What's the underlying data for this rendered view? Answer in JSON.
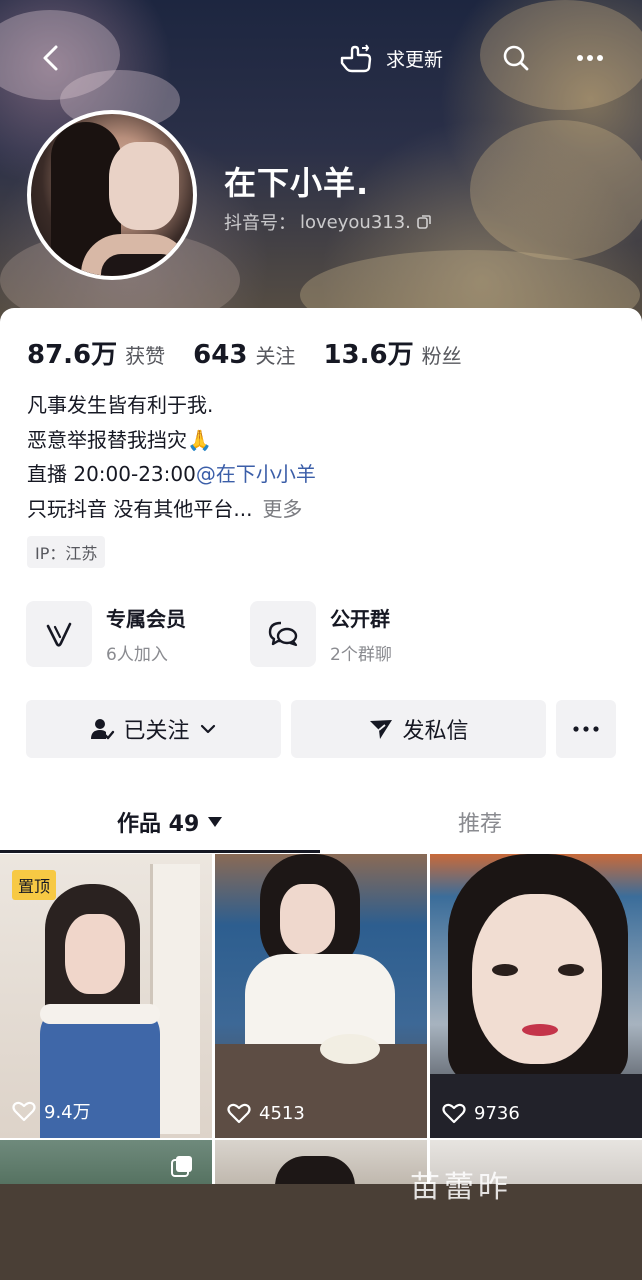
{
  "header": {
    "update_label": "求更新",
    "name": "在下小羊.",
    "douyin_id_label": "抖音号：",
    "douyin_id": "loveyou313."
  },
  "stats": [
    {
      "value": "87.6万",
      "label": "获赞"
    },
    {
      "value": "643",
      "label": "关注"
    },
    {
      "value": "13.6万",
      "label": "粉丝"
    }
  ],
  "bio": {
    "line1": "凡事发生皆有利于我.",
    "line2": "恶意举报替我挡灾🙏",
    "line3_prefix": "直播 20:00-23:00",
    "line3_mention": "@在下小小羊",
    "line4": "只玩抖音 没有其他平台...",
    "more": "更多"
  },
  "ip": "IP：江苏",
  "features": [
    {
      "title": "专属会员",
      "subtitle": "6人加入"
    },
    {
      "title": "公开群",
      "subtitle": "2个群聊"
    }
  ],
  "actions": {
    "following": "已关注",
    "message": "发私信"
  },
  "tabs": {
    "works": "作品 49",
    "recommend": "推荐"
  },
  "videos": [
    {
      "likes": "9.4万",
      "pinned": "置顶"
    },
    {
      "likes": "4513"
    },
    {
      "likes": "9736"
    }
  ],
  "overlay_text": "苗蕾昨",
  "colors": {
    "accent_mention": "#3b5ea8",
    "pin_badge": "#f7c944"
  }
}
